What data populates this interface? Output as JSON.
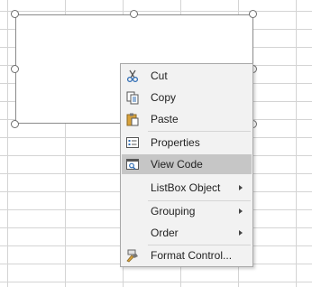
{
  "menu": {
    "items": [
      {
        "label": "Cut",
        "icon": "scissors-icon"
      },
      {
        "label": "Copy",
        "icon": "copy-icon"
      },
      {
        "label": "Paste",
        "icon": "paste-icon"
      },
      {
        "label": "Properties",
        "icon": "properties-icon"
      },
      {
        "label": "View Code",
        "icon": "view-code-icon",
        "highlighted": true
      },
      {
        "label": "ListBox Object",
        "submenu": true
      },
      {
        "label": "Grouping",
        "submenu": true
      },
      {
        "label": "Order",
        "submenu": true
      },
      {
        "label": "Format Control...",
        "icon": "format-control-icon"
      }
    ]
  },
  "colors": {
    "menu_background": "#f2f2f2",
    "highlight": "#c6c6c6",
    "gridline": "#d4d4d4"
  }
}
